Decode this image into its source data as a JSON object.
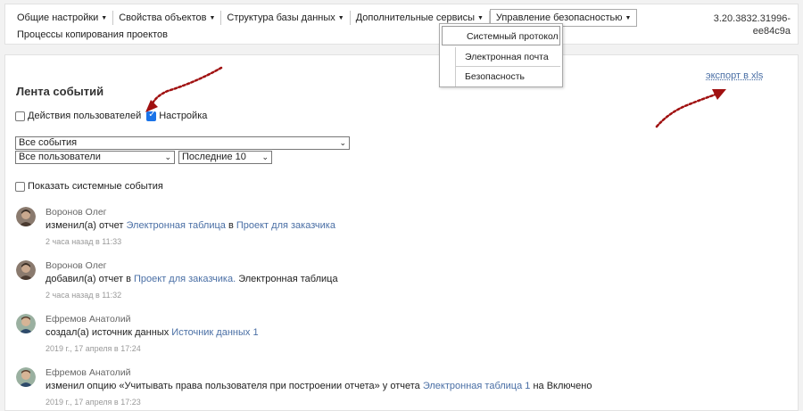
{
  "menu": {
    "items": [
      {
        "label": "Общие настройки"
      },
      {
        "label": "Свойства объектов"
      },
      {
        "label": "Структура базы данных"
      },
      {
        "label": "Дополнительные сервисы"
      },
      {
        "label": "Управление безопасностью"
      }
    ],
    "row2_label": "Процессы копирования проектов",
    "version_line1": "3.20.3832.31996-",
    "version_line2": "ee84c9a"
  },
  "dropdown": {
    "items": [
      {
        "label": "Системный протокол",
        "selected": true
      },
      {
        "label": "Электронная почта",
        "selected": false
      },
      {
        "label": "Безопасность",
        "selected": false
      }
    ]
  },
  "panel": {
    "title": "Лента событий",
    "export_label": "экспорт в xls",
    "checkbox_user_actions": "Действия пользователей",
    "checkbox_settings": "Настройка",
    "select_events": "Все события",
    "select_users": "Все пользователи",
    "select_last": "Последние 10",
    "show_system_events": "Показать системные события"
  },
  "feed": [
    {
      "name": "Воронов Олег",
      "pre": "изменил(а) отчет ",
      "link1": "Электронная таблица",
      "mid": " в ",
      "link2": "Проект для заказчика",
      "post": "",
      "time": "2 часа назад в 11:33"
    },
    {
      "name": "Воронов Олег",
      "pre": "добавил(а) отчет в ",
      "link1": "Проект для заказчика.",
      "mid": " Электронная таблица",
      "link2": "",
      "post": "",
      "time": "2 часа назад в 11:32"
    },
    {
      "name": "Ефремов Анатолий",
      "pre": "создал(а) источник данных ",
      "link1": "Источник данных 1",
      "mid": "",
      "link2": "",
      "post": "",
      "time": "2019 г., 17 апреля в 17:24"
    },
    {
      "name": "Ефремов Анатолий",
      "pre": "изменил опцию «Учитывать права пользователя при построении отчета» у отчета ",
      "link1": "Электронная таблица 1",
      "mid": " на Включено",
      "link2": "",
      "post": "",
      "time": "2019 г., 17 апреля в 17:23"
    }
  ],
  "colors": {
    "link": "#4a6fa5",
    "checkbox_on": "#1a73e8",
    "annotation_arrow": "#a01010"
  }
}
